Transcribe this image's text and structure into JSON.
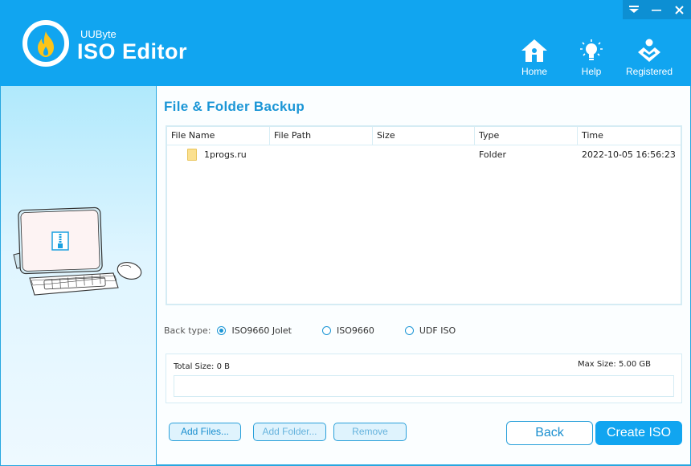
{
  "app": {
    "brand_small": "UUByte",
    "brand_name": "ISO Editor"
  },
  "window_controls": [
    {
      "name": "menu-dropdown",
      "icon": "dropdown-icon"
    },
    {
      "name": "minimize",
      "icon": "minimize-icon"
    },
    {
      "name": "close",
      "icon": "close-icon"
    }
  ],
  "nav": {
    "home": {
      "label": "Home",
      "icon": "home-icon"
    },
    "help": {
      "label": "Help",
      "icon": "lightbulb-icon"
    },
    "registered": {
      "label": "Registered",
      "icon": "registered-user-icon"
    }
  },
  "main": {
    "title": "File & Folder Backup",
    "table": {
      "columns": [
        "File Name",
        "File Path",
        "Size",
        "Type",
        "Time"
      ],
      "rows": [
        {
          "name": "1progs.ru",
          "path": "",
          "size": "",
          "type": "Folder",
          "time": "2022-10-05 16:56:23",
          "icon": "folder-icon"
        }
      ]
    },
    "back_type": {
      "label": "Back type:",
      "options": [
        "ISO9660 Jolet",
        "ISO9660",
        "UDF ISO"
      ],
      "selected": "ISO9660 Jolet"
    },
    "size": {
      "total_label": "Total Size: 0 B",
      "max_label": "Max Size: 5.00 GB",
      "progress_fraction": 0
    },
    "buttons": {
      "add_files": "Add Files...",
      "add_folder": "Add Folder...",
      "remove": "Remove",
      "back": "Back",
      "create_iso": "Create ISO"
    }
  },
  "colors": {
    "brand_blue": "#11a5f0",
    "title_blue": "#1b96d6",
    "flame_yellow": "#fcc419"
  }
}
